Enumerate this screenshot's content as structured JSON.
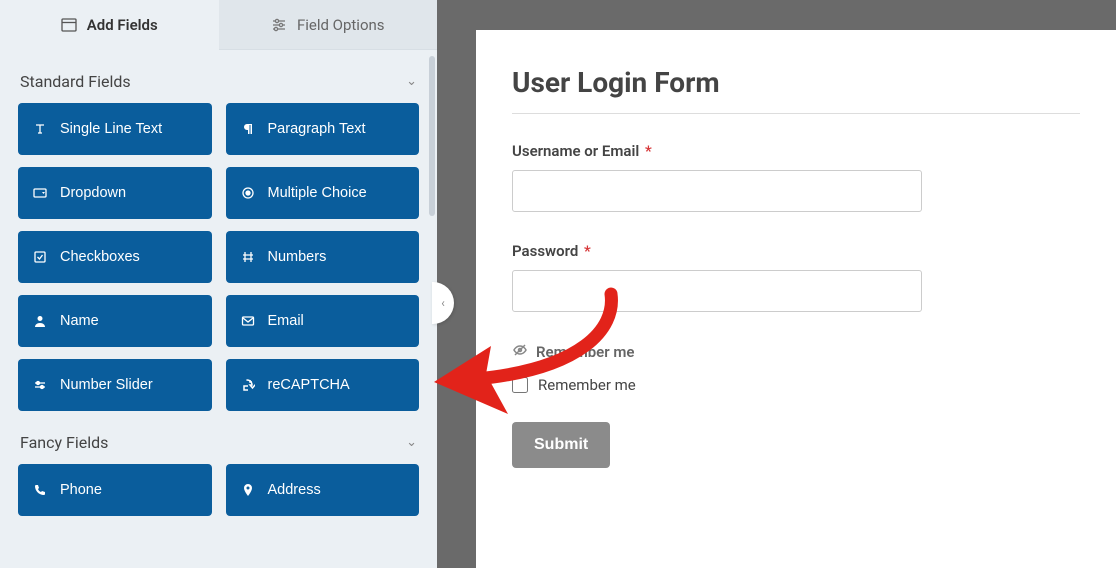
{
  "tabs": {
    "add_fields": "Add Fields",
    "field_options": "Field Options"
  },
  "sections": {
    "standard": {
      "title": "Standard Fields",
      "fields": [
        {
          "label": "Single Line Text",
          "icon": "text-icon"
        },
        {
          "label": "Paragraph Text",
          "icon": "paragraph-icon"
        },
        {
          "label": "Dropdown",
          "icon": "dropdown-icon"
        },
        {
          "label": "Multiple Choice",
          "icon": "radio-icon"
        },
        {
          "label": "Checkboxes",
          "icon": "checkbox-icon"
        },
        {
          "label": "Numbers",
          "icon": "hash-icon"
        },
        {
          "label": "Name",
          "icon": "user-icon"
        },
        {
          "label": "Email",
          "icon": "email-icon"
        },
        {
          "label": "Number Slider",
          "icon": "slider-icon"
        },
        {
          "label": "reCAPTCHA",
          "icon": "recaptcha-icon"
        }
      ]
    },
    "fancy": {
      "title": "Fancy Fields",
      "fields": [
        {
          "label": "Phone",
          "icon": "phone-icon"
        },
        {
          "label": "Address",
          "icon": "pin-icon"
        }
      ]
    }
  },
  "preview": {
    "title": "User Login Form",
    "username_label": "Username or Email",
    "password_label": "Password",
    "remember_header": "Remember me",
    "remember_option": "Remember me",
    "submit": "Submit",
    "required_mark": "*"
  }
}
